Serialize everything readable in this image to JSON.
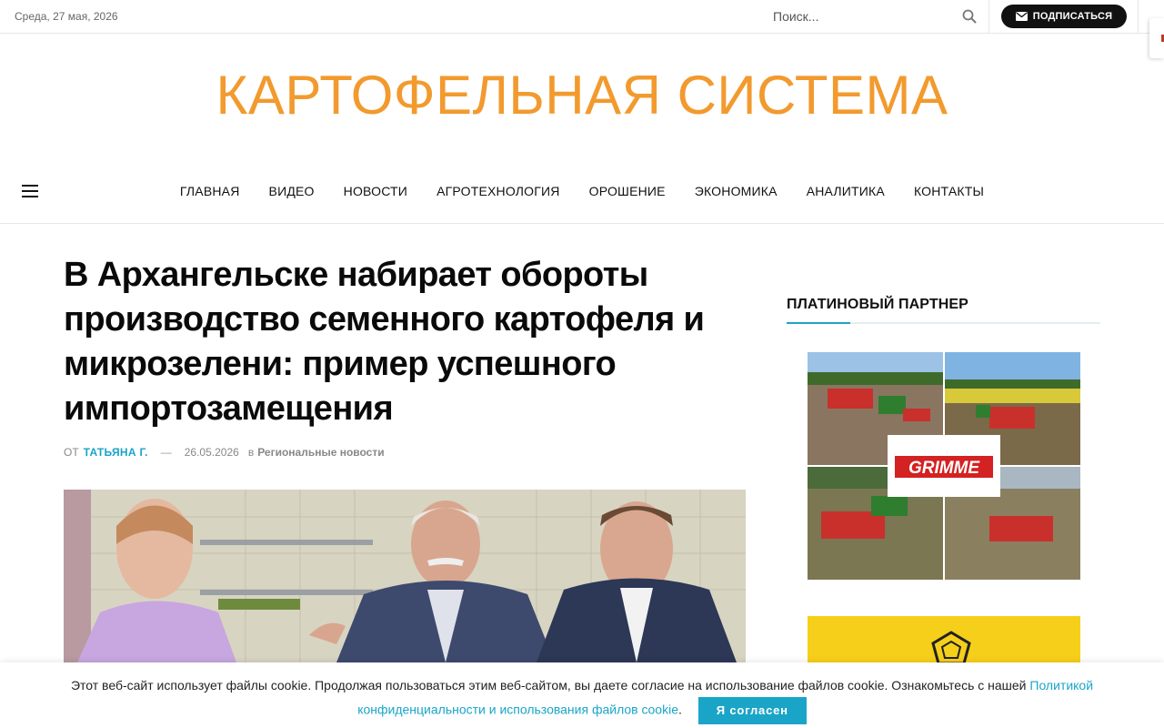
{
  "topbar": {
    "date": "Среда, 27 мая, 2026",
    "search_placeholder": "Поиск...",
    "subscribe_label": "ПОДПИСАТЬСЯ"
  },
  "site": {
    "logo": "КАРТОФЕЛЬНАЯ СИСТЕМА"
  },
  "nav": {
    "items": [
      {
        "label": "ГЛАВНАЯ"
      },
      {
        "label": "ВИДЕО"
      },
      {
        "label": "НОВОСТИ"
      },
      {
        "label": "АГРОТЕХНОЛОГИЯ"
      },
      {
        "label": "ОРОШЕНИЕ"
      },
      {
        "label": "ЭКОНОМИКА"
      },
      {
        "label": "АНАЛИТИКА"
      },
      {
        "label": "КОНТАКТЫ"
      }
    ]
  },
  "article": {
    "title": "В Архангельске набирает обороты производство семенного картофеля и микрозелени: пример успешного импортозамещения",
    "by_prefix": "ОТ",
    "author": "ТАТЬЯНА Г.",
    "dash": "—",
    "date": "26.05.2026",
    "in_prefix": "в",
    "category": "Региональные новости"
  },
  "sidebar": {
    "widget_title": "ПЛАТИНОВЫЙ ПАРТНЕР",
    "ad_brand": "GRIMME"
  },
  "cookie": {
    "text": "Этот веб-сайт использует файлы cookie. Продолжая пользоваться этим веб-сайтом, вы даете согласие на использование файлов cookie. Ознакомьтесь с нашей",
    "link_text": "Политикой конфиденциальности и использования файлов cookie",
    "period": ".",
    "agree_label": "Я согласен"
  },
  "colors": {
    "logo": "#f29a2e",
    "accent": "#1aa5c8",
    "brand_red": "#d42121"
  },
  "icons": {
    "search": "search-icon",
    "mail": "mail-icon",
    "menu": "menu-icon"
  }
}
